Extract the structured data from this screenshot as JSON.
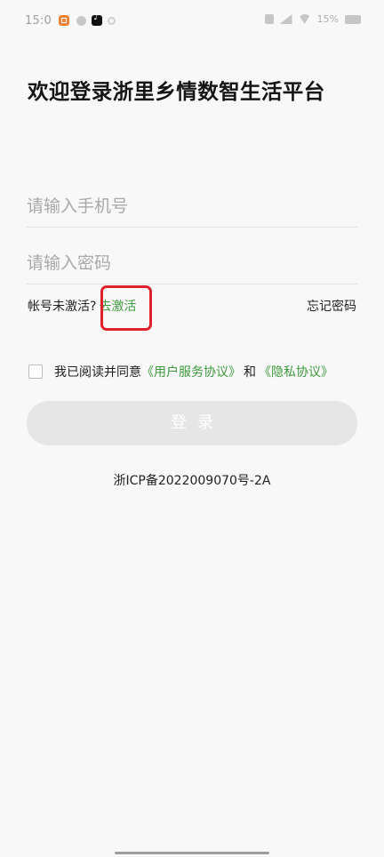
{
  "status_bar": {
    "time": "15:0",
    "right_text": "15%"
  },
  "title": "欢迎登录浙里乡情数智生活平台",
  "phone_input": {
    "value": "",
    "placeholder": "请输入手机号"
  },
  "password_input": {
    "value": "",
    "placeholder": "请输入密码"
  },
  "activate": {
    "prompt": "帐号未激活?",
    "link": "去激活"
  },
  "forgot_password": "忘记密码",
  "agreement": {
    "prefix": "我已阅读并同意",
    "user_agreement": "《用户服务协议》",
    "and": "和",
    "privacy_policy": "《隐私协议》",
    "checked": false
  },
  "login_button": "登录",
  "icp": "浙ICP备2022009070号-2A",
  "colors": {
    "accent_green": "#3d9a3d",
    "highlight_red": "#e0202a",
    "button_disabled": "#e6e6e6"
  },
  "icons": [
    "orange-app-icon",
    "tiktok-icon",
    "vibrate-icon",
    "signal-icon",
    "wifi-icon",
    "battery-icon"
  ]
}
